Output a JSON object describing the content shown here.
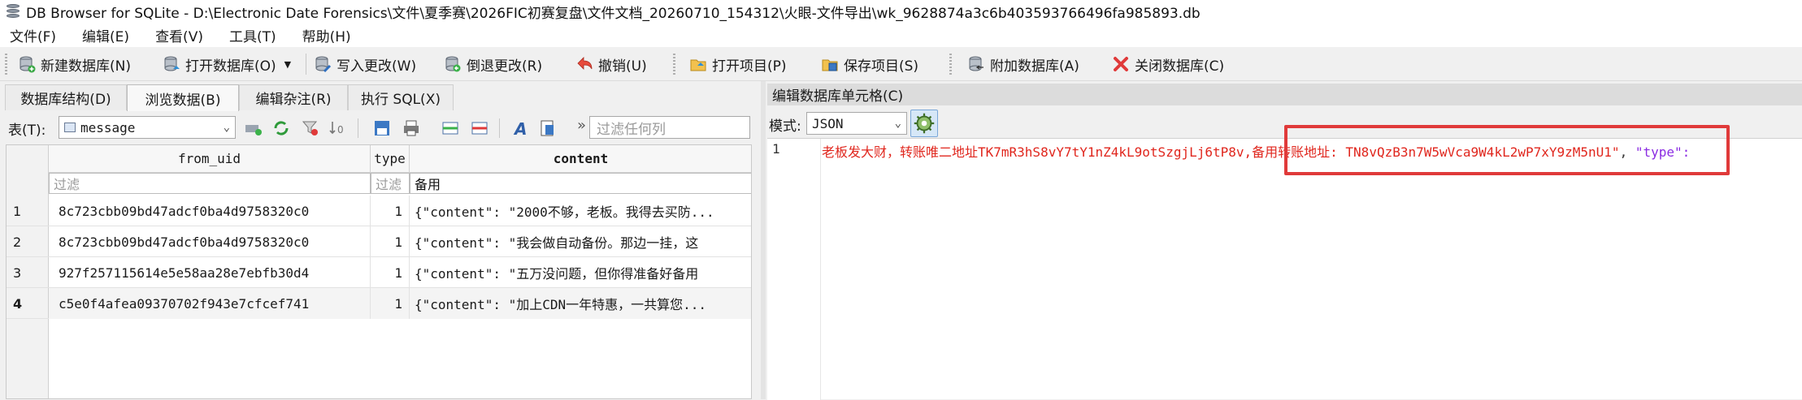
{
  "window": {
    "title": "DB Browser for SQLite - D:\\Electronic Date Forensics\\文件\\夏季赛\\2026FIC初赛复盘\\文件文档_20260710_154312\\火眼-文件导出\\wk_9628874a3c6b403593766496fa985893.db"
  },
  "menu": [
    "文件(F)",
    "编辑(E)",
    "查看(V)",
    "工具(T)",
    "帮助(H)"
  ],
  "toolbar": {
    "new_db": "新建数据库(N)",
    "open_db": "打开数据库(O)",
    "write_changes": "写入更改(W)",
    "revert_changes": "倒退更改(R)",
    "undo": "撤销(U)",
    "open_project": "打开项目(P)",
    "save_project": "保存项目(S)",
    "attach_db": "附加数据库(A)",
    "close_db": "关闭数据库(C)"
  },
  "tabs": [
    "数据库结构(D)",
    "浏览数据(B)",
    "编辑杂注(R)",
    "执行 SQL(X)"
  ],
  "active_tab": 1,
  "browse": {
    "table_label": "表(T):",
    "table_name": "message",
    "filter_placeholder": "过滤任何列",
    "columns": [
      "from_uid",
      "type",
      "content"
    ],
    "filters": [
      "过滤",
      "过滤",
      "备用"
    ],
    "rows": [
      {
        "n": "1",
        "from_uid": "8c723cbb09bd47adcf0ba4d9758320c0",
        "type": "1",
        "content": "{\"content\": \"2000不够，老板。我得去买防..."
      },
      {
        "n": "2",
        "from_uid": "8c723cbb09bd47adcf0ba4d9758320c0",
        "type": "1",
        "content": "{\"content\": \"我会做自动备份。那边一挂，这"
      },
      {
        "n": "3",
        "from_uid": "927f257115614e5e58aa28e7ebfb30d4",
        "type": "1",
        "content": "{\"content\": \"五万没问题，但你得准备好备用"
      },
      {
        "n": "4",
        "from_uid": "c5e0f4afea09370702f943e7cfcef741",
        "type": "1",
        "content": "{\"content\": \"加上CDN一年特惠，一共算您..."
      }
    ]
  },
  "cell_editor": {
    "title": "编辑数据库单元格(C)",
    "mode_label": "模式:",
    "mode_value": "JSON",
    "line_number": "1",
    "text_red": "老板发大财，转账唯二地址TK7mR3hS8vY7tY1nZ4kL9otSzgjLj6tP8v,备用转账地址: TN8vQzB3n7W5wVca9W4kL2wP7xY9zM5nU1\"",
    "text_punct": ", ",
    "text_key": "\"type\":"
  },
  "colors": {
    "highlight_box": "#e03a3a",
    "editor_string": "#e0261d",
    "editor_key": "#8a2be2"
  }
}
